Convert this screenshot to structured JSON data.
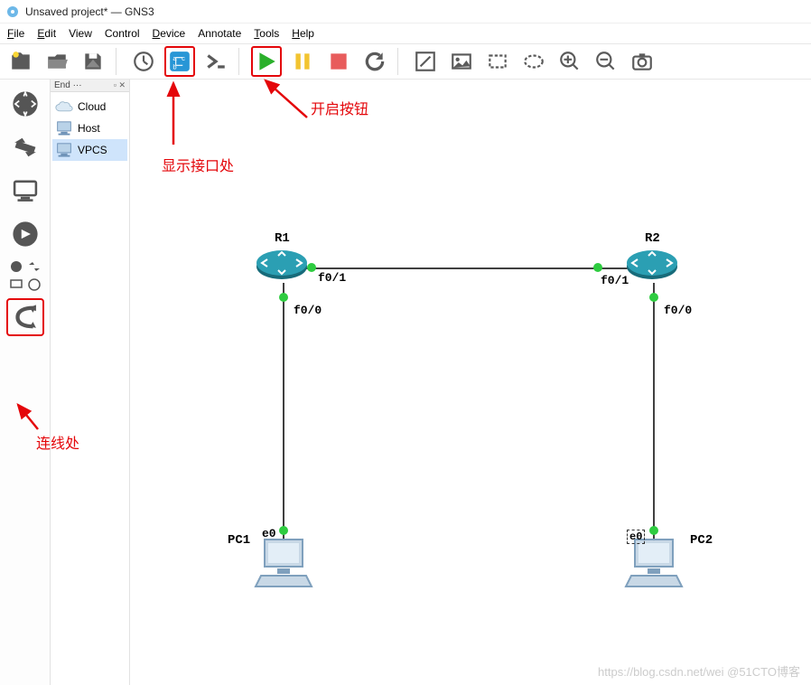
{
  "titlebar": {
    "title": "Unsaved project* — GNS3"
  },
  "menu": {
    "file": "File",
    "edit": "Edit",
    "view": "View",
    "control": "Control",
    "device": "Device",
    "annotate": "Annotate",
    "tools": "Tools",
    "help": "Help"
  },
  "devices_panel": {
    "header": "End ···",
    "items": [
      {
        "label": "Cloud",
        "selected": false
      },
      {
        "label": "Host",
        "selected": false
      },
      {
        "label": "VPCS",
        "selected": true
      }
    ]
  },
  "topology": {
    "nodes": {
      "R1": {
        "label": "R1"
      },
      "R2": {
        "label": "R2"
      },
      "PC1": {
        "label": "PC1"
      },
      "PC2": {
        "label": "PC2"
      }
    },
    "interfaces": {
      "r1_f01": "f0/1",
      "r2_f01": "f0/1",
      "r1_f00": "f0/0",
      "r2_f00": "f0/0",
      "pc1_e0": "e0",
      "pc2_e0": "e0"
    }
  },
  "annotations": {
    "start_button": "开启按钮",
    "show_interfaces": "显示接口处",
    "link_tool": "连线处"
  },
  "watermark": "https://blog.csdn.net/wei @51CTO博客"
}
